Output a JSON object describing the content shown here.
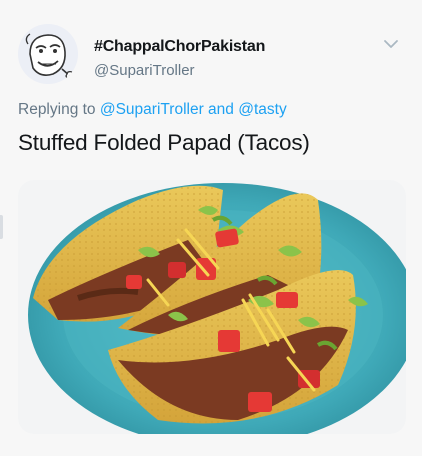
{
  "author": {
    "display_name": "#ChappalChorPakistan",
    "handle": "@SupariTroller"
  },
  "reply": {
    "prefix": "Replying to ",
    "mention_1": "@SupariTroller",
    "conjunction": " and ",
    "mention_2": "@tasty"
  },
  "tweet_text": "Stuffed Folded Papad (Tacos)",
  "icons": {
    "menu": "chevron-down-icon",
    "avatar": "avatar-image"
  },
  "colors": {
    "link": "#1da1f2",
    "secondary_text": "#657786",
    "primary_text": "#14171a",
    "plate": "#3fa9b8",
    "taco_shell": "#e2b94a"
  }
}
